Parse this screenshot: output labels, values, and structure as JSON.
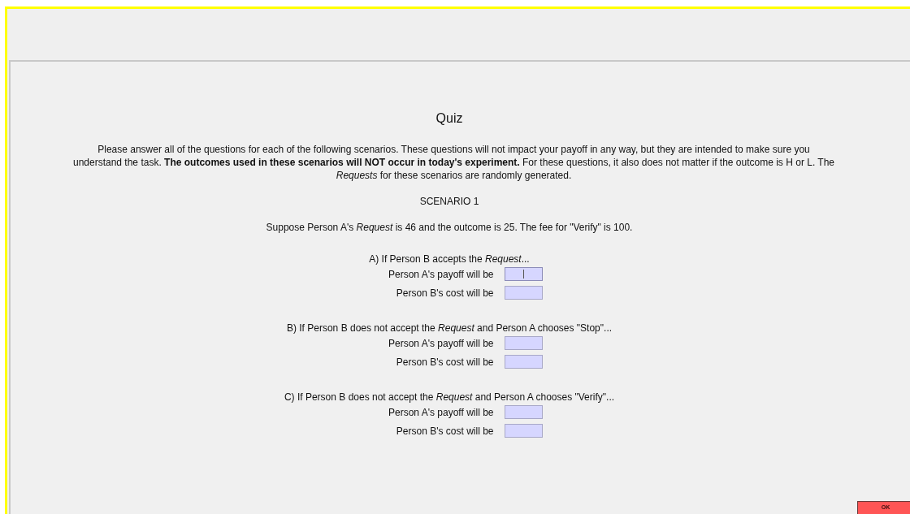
{
  "title": "Quiz",
  "intro_lines": [
    "Please answer all of the questions for each of the following scenarios. These questions will not impact your payoff in any way, but they are intended to make sure you",
    "understand the task. **The outcomes used in these scenarios will NOT occur in today's experiment.** For these questions, it also does not matter if the outcome is H or L. The",
    "*Requests* for these scenarios are randomly generated."
  ],
  "scenario": {
    "label": "SCENARIO 1",
    "description": "Suppose Person A's *Request* is 46 and the outcome is 25. The fee for \"Verify\" is 100."
  },
  "questions": [
    {
      "prompt": "A) If Person B accepts the *Request*...",
      "fields": [
        {
          "label": "Person A's payoff will be",
          "focused": true
        },
        {
          "label": "Person B's cost will be",
          "focused": false
        }
      ]
    },
    {
      "prompt": "B) If Person B does not accept the *Request* and Person A chooses \"Stop\"...",
      "fields": [
        {
          "label": "Person A's payoff will be",
          "focused": false
        },
        {
          "label": "Person B's cost will be",
          "focused": false
        }
      ]
    },
    {
      "prompt": "C) If Person B does not accept the *Request* and Person A chooses \"Verify\"...",
      "fields": [
        {
          "label": "Person A's payoff will be",
          "focused": false
        },
        {
          "label": "Person B's cost will be",
          "focused": false
        }
      ]
    }
  ],
  "ok_button": "OK"
}
